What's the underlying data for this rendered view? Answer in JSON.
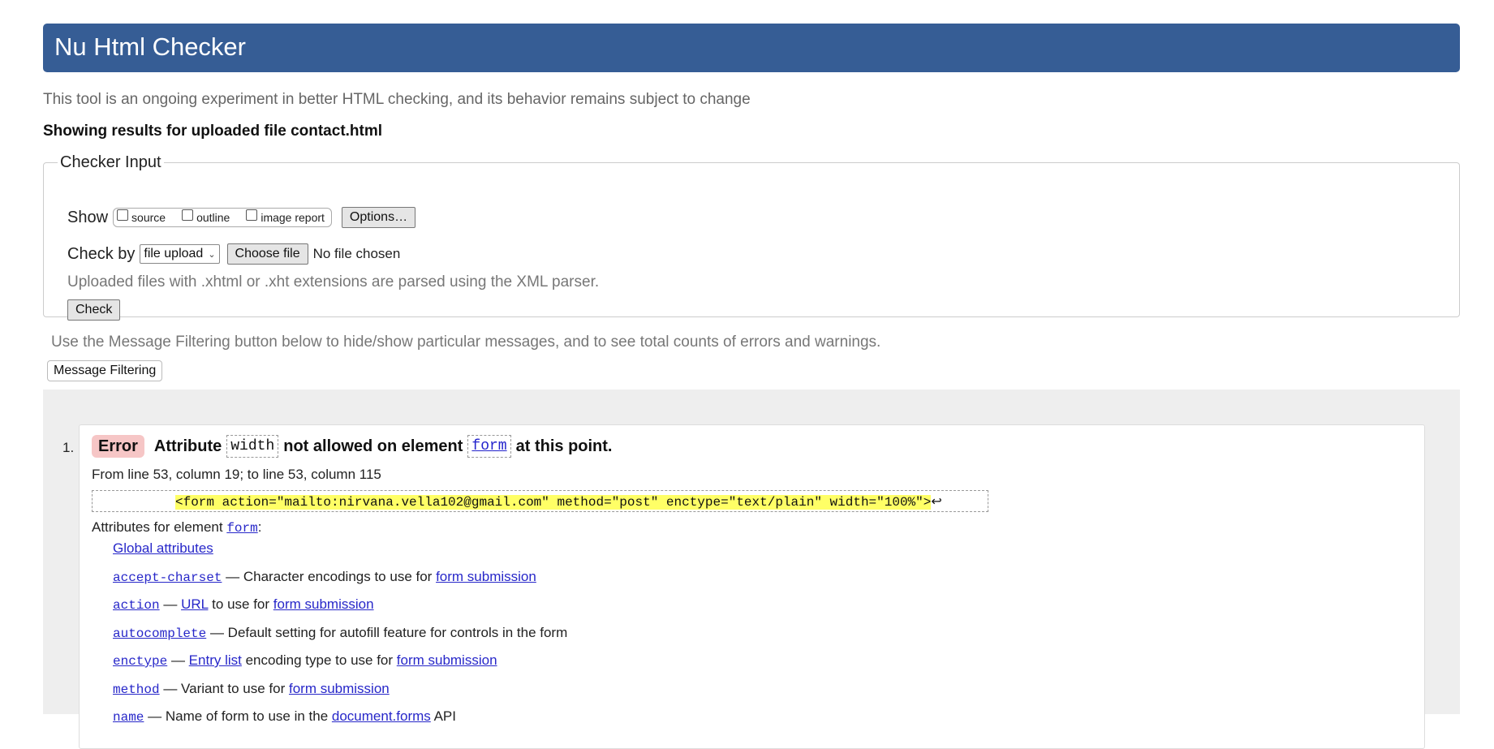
{
  "header": {
    "title": "Nu Html Checker"
  },
  "tagline": "This tool is an ongoing experiment in better HTML checking, and its behavior remains subject to change",
  "showing": "Showing results for uploaded file contact.html",
  "checker": {
    "legend": "Checker Input",
    "show_label": "Show",
    "show_options": [
      "source",
      "outline",
      "image report"
    ],
    "options_button": "Options…",
    "check_by_label": "Check by",
    "check_by_value": "file upload",
    "choose_file": "Choose file",
    "no_file": "No file chosen",
    "xml_note": "Uploaded files with .xhtml or .xht extensions are parsed using the XML parser.",
    "check_button": "Check"
  },
  "filter": {
    "note": "Use the Message Filtering button below to hide/show particular messages, and to see total counts of errors and warnings.",
    "button": "Message Filtering"
  },
  "message": {
    "number": "1.",
    "type": "Error",
    "text_1": "Attribute",
    "attr": "width",
    "text_2": "not allowed on element",
    "element": "form",
    "text_3": "at this point.",
    "location": "From line 53, column 19; to line 53, column 115",
    "extract": "<form action=\"mailto:nirvana.vella102@gmail.com\" method=\"post\" enctype=\"text/plain\" width=\"100%\">",
    "return_symbol": "↩",
    "attrs_title_prefix": "Attributes for element",
    "attrs_title_element": "form",
    "attrs_title_suffix": ":",
    "attributes": [
      {
        "code": "",
        "link1": "Global attributes",
        "text": "",
        "link2": "",
        "text2": "",
        "link3": ""
      },
      {
        "code": "accept-charset",
        "link1": "",
        "text": " — Character encodings to use for ",
        "link2": "form submission",
        "text2": "",
        "link3": ""
      },
      {
        "code": "action",
        "link1": "",
        "text": " — ",
        "link2": "URL",
        "text2": " to use for ",
        "link3": "form submission"
      },
      {
        "code": "autocomplete",
        "link1": "",
        "text": " — Default setting for autofill feature for controls in the form",
        "link2": "",
        "text2": "",
        "link3": ""
      },
      {
        "code": "enctype",
        "link1": "",
        "text": " — ",
        "link2": "Entry list",
        "text2": " encoding type to use for ",
        "link3": "form submission"
      },
      {
        "code": "method",
        "link1": "",
        "text": " — Variant to use for ",
        "link2": "form submission",
        "text2": "",
        "link3": ""
      },
      {
        "code": "name",
        "link1": "",
        "text": " — Name of form to use in the ",
        "link2": "document.forms",
        "text2": " API",
        "link3": ""
      }
    ]
  }
}
